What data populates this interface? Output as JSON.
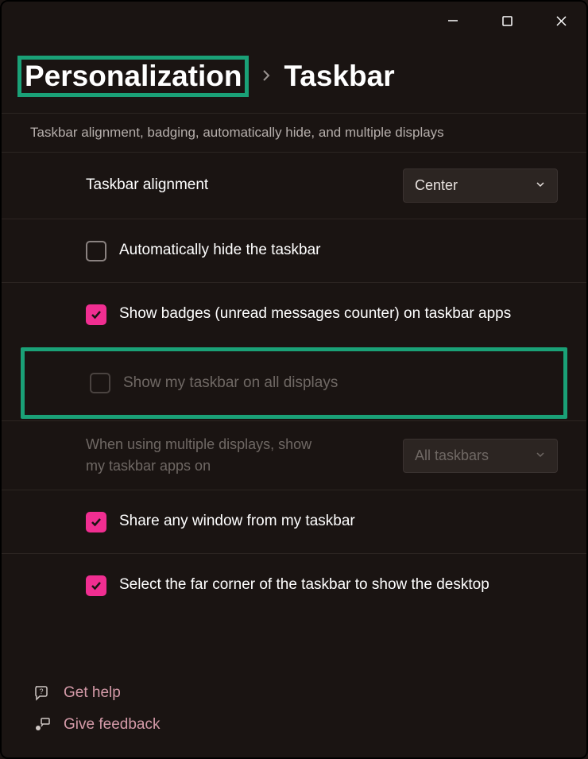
{
  "breadcrumb": {
    "parent": "Personalization",
    "current": "Taskbar"
  },
  "section": {
    "description": "Taskbar alignment, badging, automatically hide, and multiple displays"
  },
  "settings": {
    "alignment": {
      "label": "Taskbar alignment",
      "value": "Center"
    },
    "autoHide": {
      "label": "Automatically hide the taskbar",
      "checked": false
    },
    "showBadges": {
      "label": "Show badges (unread messages counter) on taskbar apps",
      "checked": true
    },
    "allDisplays": {
      "label": "Show my taskbar on all displays",
      "checked": false,
      "disabled": true
    },
    "multiDisplay": {
      "label": "When using multiple displays, show my taskbar apps on",
      "value": "All taskbars",
      "disabled": true
    },
    "shareWindow": {
      "label": "Share any window from my taskbar",
      "checked": true
    },
    "farCorner": {
      "label": "Select the far corner of the taskbar to show the desktop",
      "checked": true
    }
  },
  "links": {
    "help": "Get help",
    "feedback": "Give feedback"
  },
  "colors": {
    "accent": "#f02e91",
    "highlight": "#1aa177"
  }
}
